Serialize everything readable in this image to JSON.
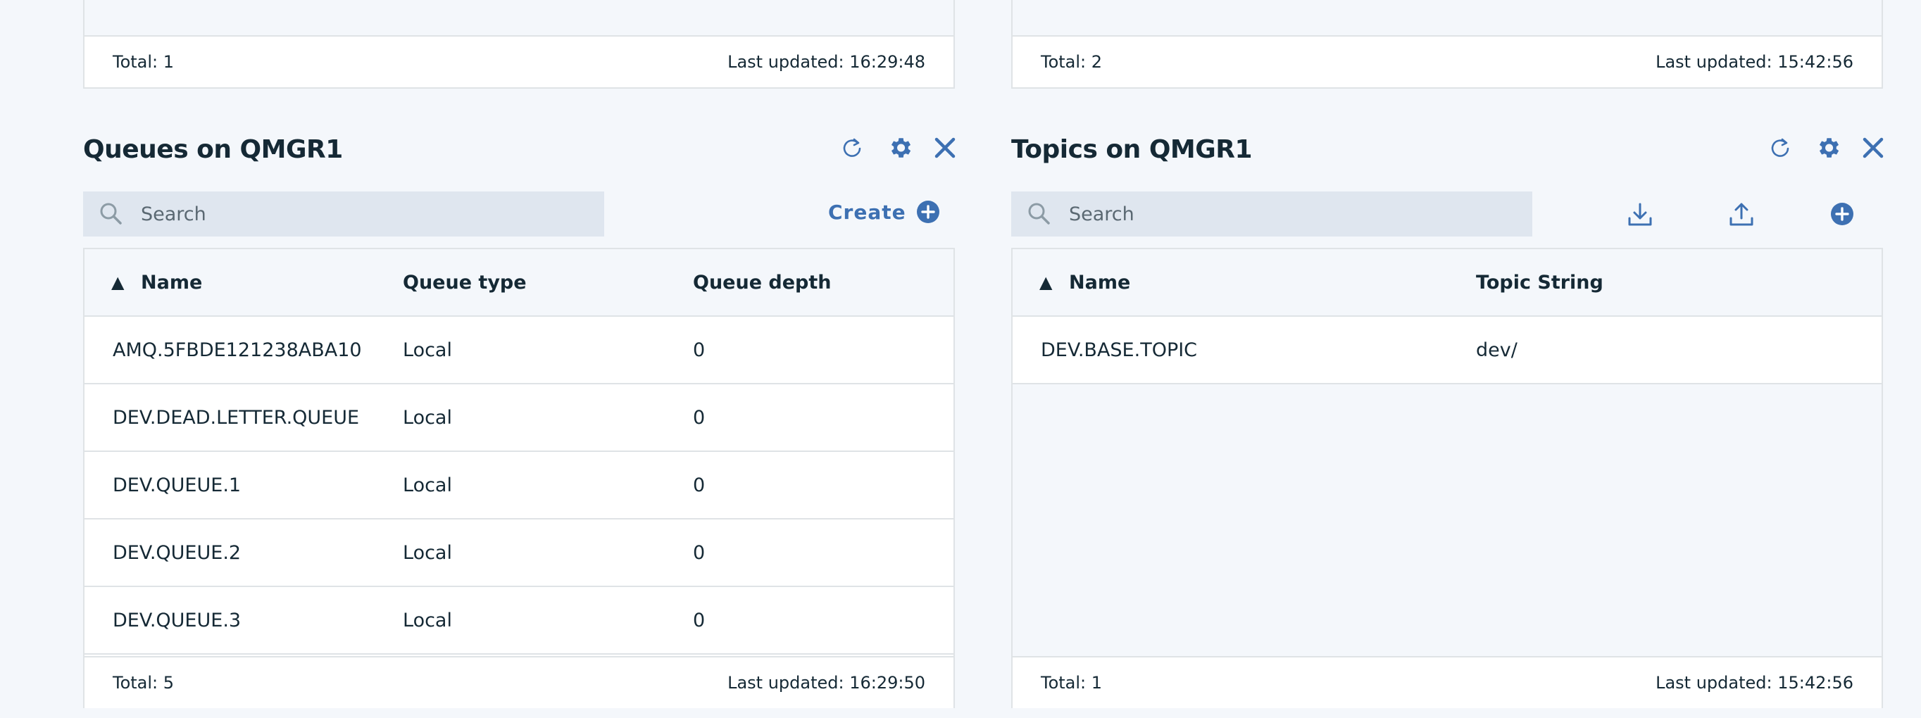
{
  "top_left_panel": {
    "total": "Total: 1",
    "last_updated": "Last updated: 16:29:48"
  },
  "top_right_panel": {
    "total": "Total: 2",
    "last_updated": "Last updated: 15:42:56"
  },
  "queues": {
    "title": "Queues on QMGR1",
    "search_placeholder": "Search",
    "create_label": "Create",
    "sort_indicator": "▲",
    "columns": [
      "Name",
      "Queue type",
      "Queue depth"
    ],
    "rows": [
      [
        "AMQ.5FBDE121238ABA10",
        "Local",
        "0"
      ],
      [
        "DEV.DEAD.LETTER.QUEUE",
        "Local",
        "0"
      ],
      [
        "DEV.QUEUE.1",
        "Local",
        "0"
      ],
      [
        "DEV.QUEUE.2",
        "Local",
        "0"
      ],
      [
        "DEV.QUEUE.3",
        "Local",
        "0"
      ]
    ],
    "total": "Total: 5",
    "last_updated": "Last updated: 16:29:50"
  },
  "topics": {
    "title": "Topics on QMGR1",
    "search_placeholder": "Search",
    "sort_indicator": "▲",
    "columns": [
      "Name",
      "Topic String"
    ],
    "rows": [
      [
        "DEV.BASE.TOPIC",
        "dev/"
      ]
    ],
    "total": "Total: 1",
    "last_updated": "Last updated: 15:42:56"
  },
  "icons": {
    "accent": "#3d70b2",
    "refresh": "refresh-icon",
    "settings": "gear-icon",
    "close": "close-icon",
    "search": "search-icon",
    "add": "add-circle-icon",
    "download": "download-icon",
    "upload": "upload-icon"
  }
}
